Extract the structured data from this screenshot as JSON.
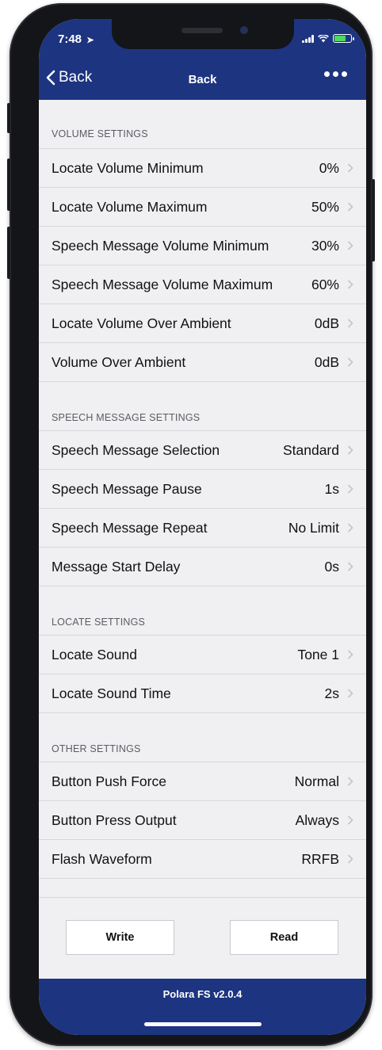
{
  "status_bar": {
    "time": "7:48",
    "location_icon": "location-arrow-icon"
  },
  "nav": {
    "back_label": "Back",
    "title": "Back",
    "more_icon": "more-dots-icon"
  },
  "sections": [
    {
      "title": "VOLUME SETTINGS",
      "rows": [
        {
          "label": "Locate Volume Minimum",
          "value": "0%"
        },
        {
          "label": "Locate Volume Maximum",
          "value": "50%"
        },
        {
          "label": "Speech Message Volume Minimum",
          "value": "30%"
        },
        {
          "label": "Speech Message Volume Maximum",
          "value": "60%"
        },
        {
          "label": "Locate Volume Over Ambient",
          "value": "0dB"
        },
        {
          "label": "Volume Over Ambient",
          "value": "0dB"
        }
      ]
    },
    {
      "title": "SPEECH MESSAGE SETTINGS",
      "rows": [
        {
          "label": "Speech Message Selection",
          "value": "Standard"
        },
        {
          "label": "Speech Message Pause",
          "value": "1s"
        },
        {
          "label": "Speech Message Repeat",
          "value": "No Limit"
        },
        {
          "label": "Message Start Delay",
          "value": "0s"
        }
      ]
    },
    {
      "title": "LOCATE SETTINGS",
      "rows": [
        {
          "label": "Locate Sound",
          "value": "Tone 1"
        },
        {
          "label": "Locate Sound Time",
          "value": "2s"
        }
      ]
    },
    {
      "title": "OTHER SETTINGS",
      "rows": [
        {
          "label": "Button Push Force",
          "value": "Normal"
        },
        {
          "label": "Button Press Output",
          "value": "Always"
        },
        {
          "label": "Flash Waveform",
          "value": "RRFB"
        }
      ]
    }
  ],
  "actions": {
    "write_label": "Write",
    "read_label": "Read"
  },
  "footer": {
    "version": "Polara FS v2.0.4"
  },
  "colors": {
    "nav_background": "#1d3480",
    "list_background": "#f0f0f3",
    "chevron": "#c4c4c8",
    "battery_fill": "#4cd964"
  }
}
